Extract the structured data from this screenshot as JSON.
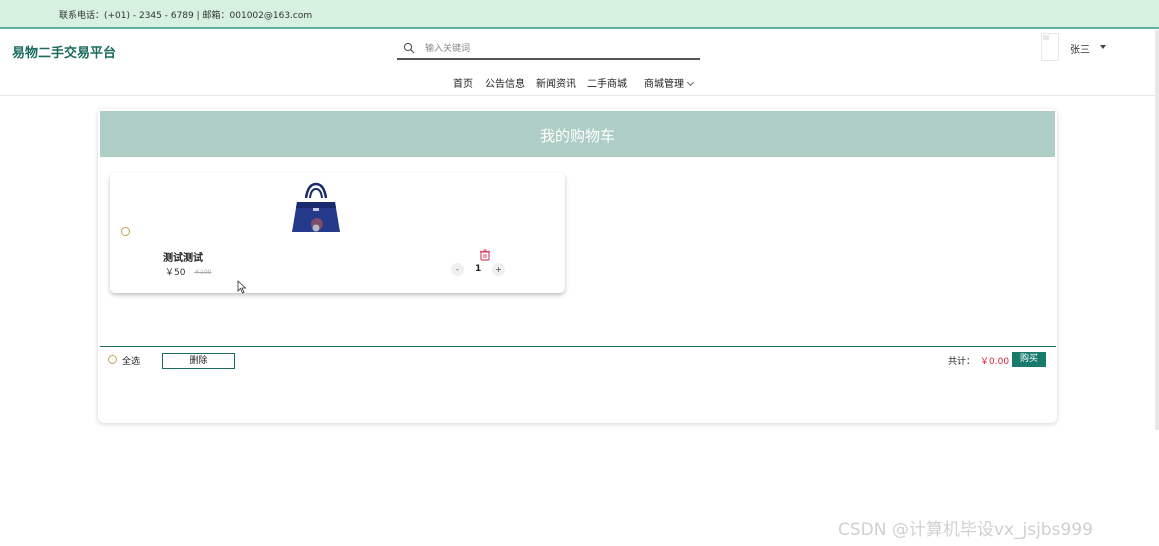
{
  "topbar": {
    "contact": "联系电话：(+01) - 2345 - 6789 | 邮箱：001002@163.com"
  },
  "header": {
    "brand": "易物二手交易平台",
    "search_placeholder": "输入关键词",
    "username": "张三"
  },
  "nav": {
    "items": [
      "首页",
      "公告信息",
      "新闻资讯",
      "二手商城",
      "商城管理"
    ]
  },
  "cart": {
    "title": "我的购物车",
    "items": [
      {
        "name": "测试测试",
        "price": "￥50",
        "old_price": "￥100",
        "quantity": "1",
        "minus": "-",
        "plus": "+"
      }
    ],
    "select_all": "全选",
    "delete": "删除",
    "total_label": "共计：",
    "total_value": "￥0.00",
    "buy": "购买"
  },
  "watermark": "CSDN @计算机毕设vx_jsjbs999",
  "colors": {
    "accent": "#177a6b",
    "topbar": "#d6f1df",
    "cart_header": "#adcdc5",
    "price_red": "#d9233b"
  },
  "icons": [
    "search-icon",
    "avatar-icon",
    "caret-down-icon",
    "chevron-down-icon",
    "trash-icon",
    "cursor-icon"
  ]
}
